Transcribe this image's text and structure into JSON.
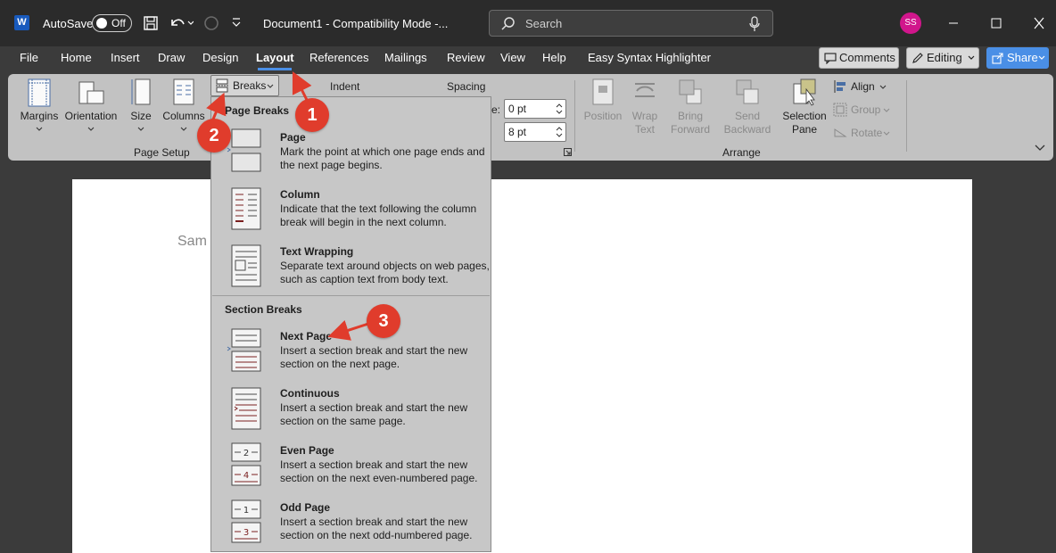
{
  "titlebar": {
    "app_logo": "W",
    "autosave_label": "AutoSave",
    "autosave_state": "Off",
    "document_title": "Document1  -  Compatibility Mode  -...",
    "search_placeholder": "Search",
    "user_initials": "SS"
  },
  "menu": {
    "tabs": [
      "File",
      "Home",
      "Insert",
      "Draw",
      "Design",
      "Layout",
      "References",
      "Mailings",
      "Review",
      "View",
      "Help",
      "Easy Syntax Highlighter"
    ],
    "active_tab": "Layout",
    "comments_label": "Comments",
    "editing_label": "Editing",
    "share_label": "Share"
  },
  "ribbon": {
    "page_setup": {
      "margins": "Margins",
      "orientation": "Orientation",
      "size": "Size",
      "columns": "Columns",
      "breaks": "Breaks",
      "group_label": "Page Setup"
    },
    "paragraph": {
      "indent_label": "Indent",
      "spacing_label": "Spacing",
      "before_suffix": "e:",
      "before_value": "0 pt",
      "after_value": "8 pt"
    },
    "arrange": {
      "position_1": "Position",
      "wrap_1": "Wrap",
      "wrap_2": "Text",
      "bring_1": "Bring",
      "bring_2": "Forward",
      "send_1": "Send",
      "send_2": "Backward",
      "selection_1": "Selection",
      "selection_2": "Pane",
      "align": "Align",
      "group": "Group",
      "rotate": "Rotate",
      "group_label": "Arrange"
    }
  },
  "document": {
    "visible_text": "Sam"
  },
  "breaks_menu": {
    "page_breaks_header": "Page Breaks",
    "section_breaks_header": "Section Breaks",
    "items": [
      {
        "title": "Page",
        "desc": "Mark the point at which one page ends and the next page begins."
      },
      {
        "title": "Column",
        "desc": "Indicate that the text following the column break will begin in the next column."
      },
      {
        "title": "Text Wrapping",
        "desc": "Separate text around objects on web pages, such as caption text from body text."
      },
      {
        "title": "Next Page",
        "desc": "Insert a section break and start the new section on the next page."
      },
      {
        "title": "Continuous",
        "desc": "Insert a section break and start the new section on the same page."
      },
      {
        "title": "Even Page",
        "desc": "Insert a section break and start the new section on the next even-numbered page."
      },
      {
        "title": "Odd Page",
        "desc": "Insert a section break and start the new section on the next odd-numbered page."
      }
    ]
  },
  "annotations": {
    "step1": "1",
    "step2": "2",
    "step3": "3",
    "color": "#e03c2c"
  },
  "colors": {
    "accent": "#4a8fe6",
    "avatar": "#d1168c",
    "word_brand": "#185abd"
  }
}
